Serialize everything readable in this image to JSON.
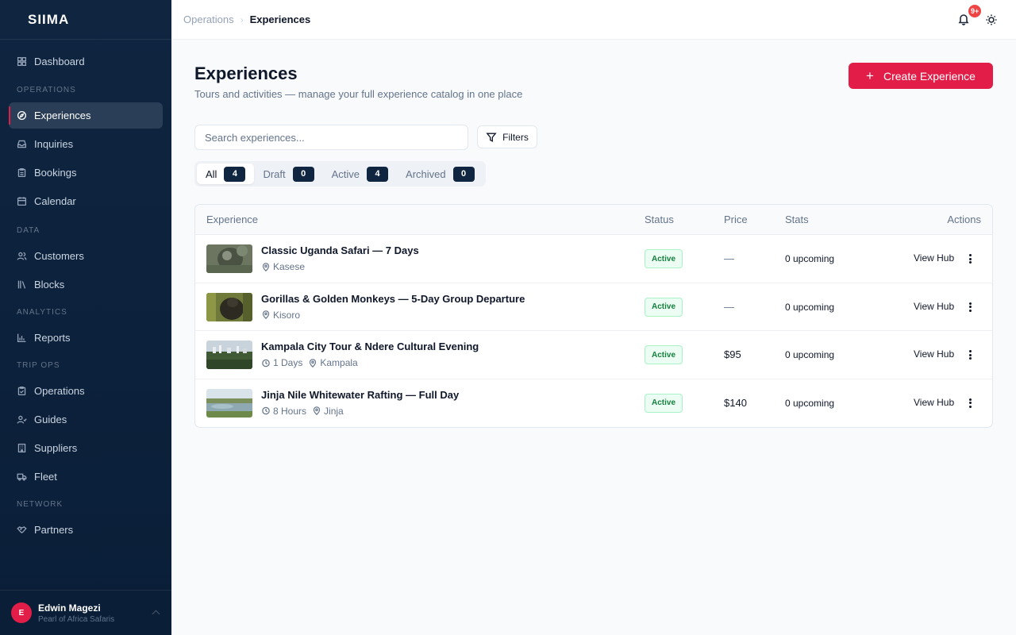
{
  "brand": "SIIMA",
  "sidebar": {
    "dashboard": "Dashboard",
    "sections": {
      "operations": "OPERATIONS",
      "data": "DATA",
      "analytics": "ANALYTICS",
      "trip_ops": "TRIP OPS",
      "network": "NETWORK"
    },
    "items": {
      "experiences": "Experiences",
      "inquiries": "Inquiries",
      "bookings": "Bookings",
      "calendar": "Calendar",
      "customers": "Customers",
      "blocks": "Blocks",
      "reports": "Reports",
      "operations": "Operations",
      "guides": "Guides",
      "suppliers": "Suppliers",
      "fleet": "Fleet",
      "partners": "Partners"
    },
    "user": {
      "initial": "E",
      "name": "Edwin Magezi",
      "org": "Pearl of Africa Safaris"
    }
  },
  "topbar": {
    "breadcrumb": [
      "Operations",
      "Experiences"
    ],
    "notification_badge": "9+"
  },
  "page": {
    "title": "Experiences",
    "subtitle": "Tours and activities — manage your full experience catalog in one place",
    "create_label": "Create Experience"
  },
  "search": {
    "placeholder": "Search experiences..."
  },
  "filters_label": "Filters",
  "tabs": [
    {
      "label": "All",
      "count": "4"
    },
    {
      "label": "Draft",
      "count": "0"
    },
    {
      "label": "Active",
      "count": "4"
    },
    {
      "label": "Archived",
      "count": "0"
    }
  ],
  "table": {
    "headers": {
      "experience": "Experience",
      "status": "Status",
      "price": "Price",
      "stats": "Stats",
      "actions": "Actions"
    },
    "rows": [
      {
        "name": "Classic Uganda Safari — 7 Days",
        "duration": "",
        "location": "Kasese",
        "status": "Active",
        "price": "—",
        "stats": "0 upcoming",
        "action": "View Hub"
      },
      {
        "name": "Gorillas & Golden Monkeys — 5-Day Group Departure",
        "duration": "",
        "location": "Kisoro",
        "status": "Active",
        "price": "—",
        "stats": "0 upcoming",
        "action": "View Hub"
      },
      {
        "name": "Kampala City Tour & Ndere Cultural Evening",
        "duration": "1 Days",
        "location": "Kampala",
        "status": "Active",
        "price": "$95",
        "stats": "0 upcoming",
        "action": "View Hub"
      },
      {
        "name": "Jinja Nile Whitewater Rafting — Full Day",
        "duration": "8 Hours",
        "location": "Jinja",
        "status": "Active",
        "price": "$140",
        "stats": "0 upcoming",
        "action": "View Hub"
      }
    ]
  },
  "colors": {
    "accent": "#e11d48",
    "sidebar": "#0f2540",
    "active_badge": "#15803d"
  }
}
